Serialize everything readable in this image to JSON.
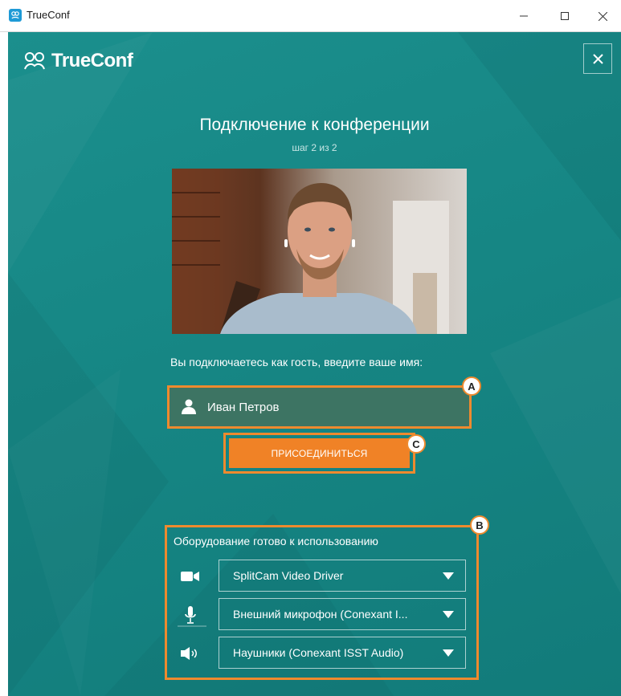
{
  "window": {
    "title": "TrueConf"
  },
  "app": {
    "logo_text": "TrueConf",
    "heading": "Подключение к конференции",
    "step": "шаг 2 из 2",
    "guest_label": "Вы подключаетесь как гость, введите ваше имя:",
    "name_value": "Иван Петров",
    "join_label": "ПРИСОЕДИНИТЬСЯ",
    "equipment_title": "Оборудование готово к использованию",
    "devices": [
      {
        "icon": "camera-icon",
        "value": "SplitCam Video Driver"
      },
      {
        "icon": "microphone-icon",
        "value": "Внешний микрофон (Conexant I..."
      },
      {
        "icon": "speaker-icon",
        "value": "Наушники (Conexant ISST Audio)"
      }
    ]
  },
  "annotations": {
    "a": "A",
    "b": "B",
    "c": "C"
  },
  "colors": {
    "background": "#168684",
    "accent": "#f08226",
    "highlight_border": "#ee8a2e",
    "field": "#3d7463"
  }
}
